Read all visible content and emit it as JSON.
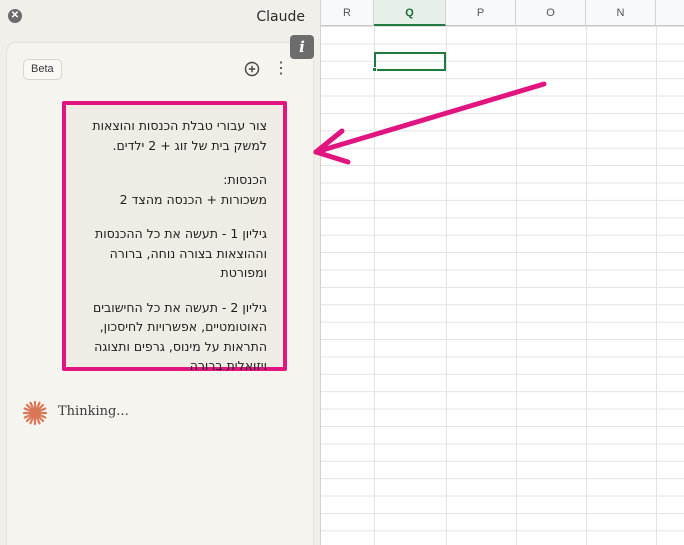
{
  "panel": {
    "title": "Claude",
    "close_icon": "close-icon",
    "beta_label": "Beta",
    "new_chat_icon": "new-chat-icon",
    "more_icon": "more-vertical-icon",
    "info_label": "i"
  },
  "message": {
    "paragraphs": [
      "צור עבורי טבלת הכנסות והוצאות\nלמשק בית של זוג + 2 ילדים.",
      "הכנסות:\nמשכורות + הכנסה מהצד 2",
      "גיליון 1 - תעשה את כל ההכנסות\nוההוצאות בצורה נוחה, ברורה\nומפורטת",
      "גיליון 2 - תעשה את כל החישובים\nהאוטומטיים, אפשרויות לחיסכון,\nהתראות על מינוס, גרפים ותצוגה\nויזואלית ברורה"
    ],
    "highlight_color": "#e0157f"
  },
  "thinking": {
    "icon": "claude-spark-icon",
    "text": "Thinking...",
    "icon_color": "#d97757"
  },
  "sheet": {
    "columns": [
      "R",
      "Q",
      "P",
      "O",
      "N"
    ],
    "selected_column": "Q",
    "accent_color": "#1e7a3f"
  },
  "annotation": {
    "arrow_color": "#e0157f"
  }
}
